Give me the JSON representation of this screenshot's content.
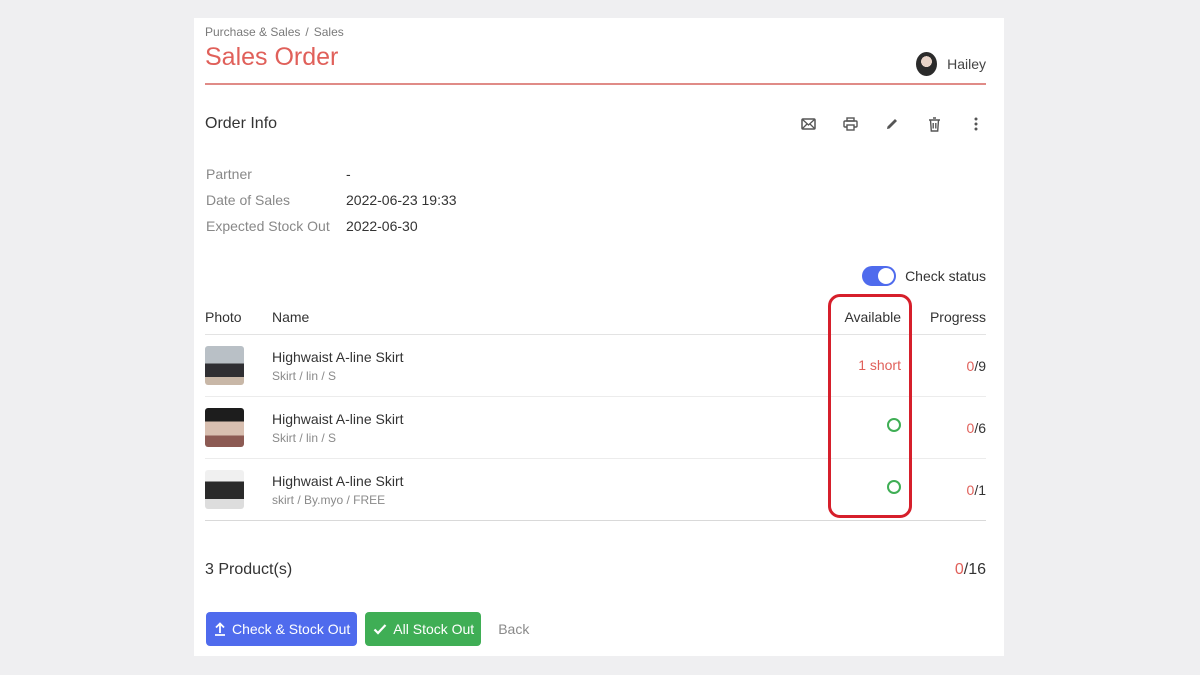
{
  "breadcrumb": [
    "Purchase & Sales",
    "Sales"
  ],
  "breadcrumb_sep": "/",
  "page_title": "Sales Order",
  "user": {
    "name": "Hailey"
  },
  "order_info": {
    "title": "Order Info",
    "tool_icons": [
      "mail-icon",
      "print-icon",
      "edit-icon",
      "trash-icon",
      "more-vertical-icon"
    ],
    "fields": [
      {
        "label": "Partner",
        "value": "-"
      },
      {
        "label": "Date of Sales",
        "value": "2022-06-23 19:33"
      },
      {
        "label": "Expected Stock Out",
        "value": "2022-06-30"
      }
    ]
  },
  "check_status": {
    "label": "Check status",
    "enabled": true
  },
  "table": {
    "headers": {
      "photo": "Photo",
      "name": "Name",
      "available": "Available",
      "progress": "Progress"
    },
    "rows": [
      {
        "name": "Highwaist A-line Skirt",
        "variant": "Skirt / lin / S",
        "available": "1 short",
        "available_ok": false,
        "progress_done": "0",
        "progress_total": "/9"
      },
      {
        "name": "Highwaist A-line Skirt",
        "variant": "Skirt / lin / S",
        "available": "",
        "available_ok": true,
        "progress_done": "0",
        "progress_total": "/6"
      },
      {
        "name": "Highwaist A-line Skirt",
        "variant": "skirt / By.myo / FREE",
        "available": "",
        "available_ok": true,
        "progress_done": "0",
        "progress_total": "/1"
      }
    ]
  },
  "summary": {
    "count_label": "3 Product(s)",
    "progress_done": "0",
    "progress_total": "/16"
  },
  "actions": {
    "check_stock_out": "Check & Stock Out",
    "all_stock_out": "All Stock Out",
    "back": "Back"
  },
  "colors": {
    "accent_red": "#e0605a",
    "primary": "#4f6bed",
    "success": "#3fae55",
    "highlight": "#d61f2b"
  }
}
